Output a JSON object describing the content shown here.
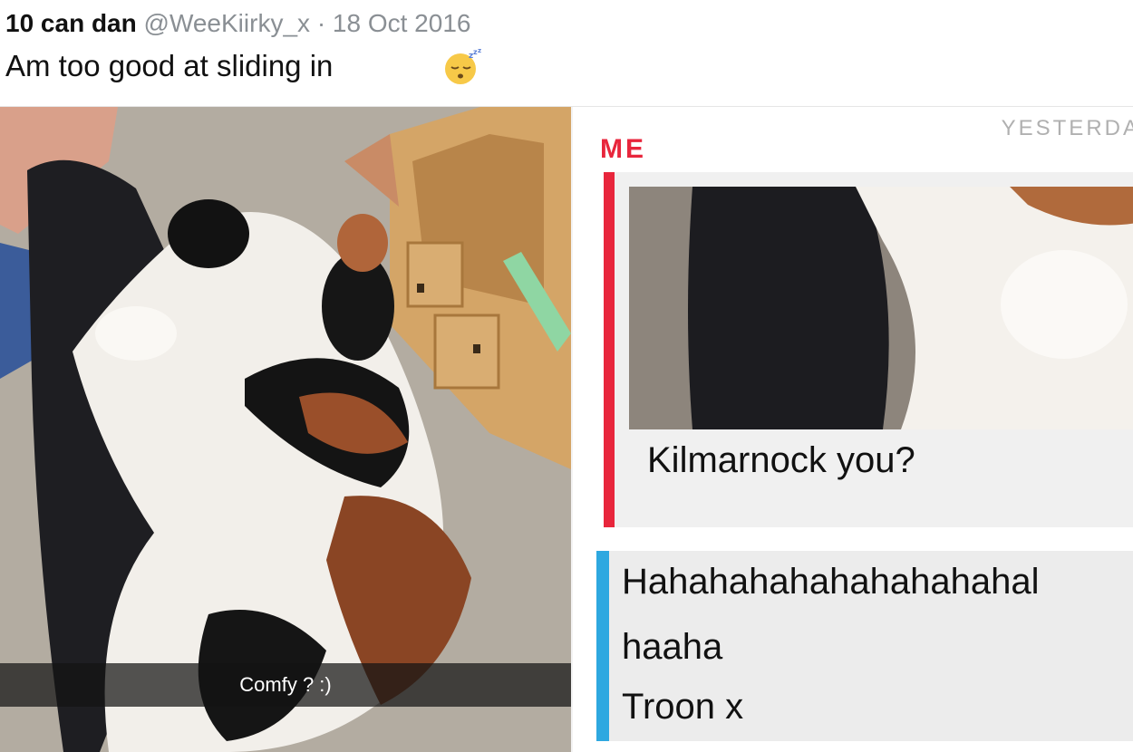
{
  "tweet": {
    "display_name": "10 can dan",
    "handle": "@WeeKiirky_x",
    "separator": "·",
    "date": "18 Oct 2016",
    "text": "Am too good at sliding in",
    "emoji_icon": "sleeping-face-emoji"
  },
  "snap": {
    "caption": "Comfy ? :)"
  },
  "chat": {
    "day_label": "YESTERDA",
    "sender_label": "ME",
    "me_message": "Kilmarnock you?",
    "reply_lines": [
      "Hahahahahahahahahahal",
      "haaha",
      "Troon x"
    ],
    "me_color": "#e8263c",
    "reply_color": "#2ea8e0"
  }
}
